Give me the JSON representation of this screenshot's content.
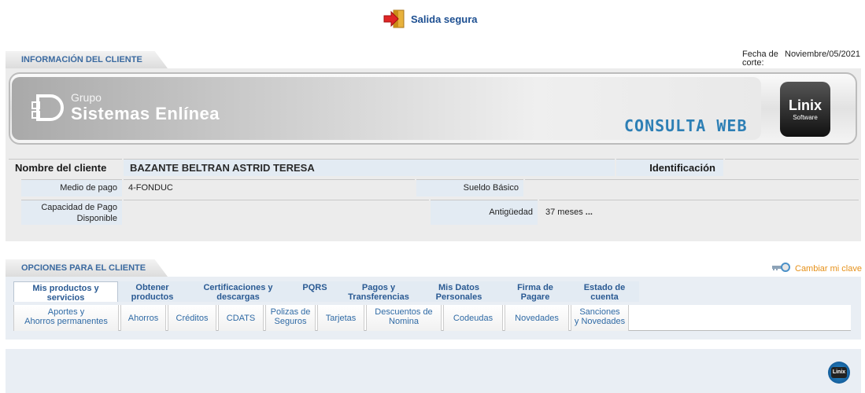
{
  "header": {
    "logout_label": "Salida segura"
  },
  "client_section": {
    "title": "INFORMACIÓN DEL CLIENTE",
    "fecha_label": "Fecha de corte:",
    "fecha_value": "Noviembre/05/2021",
    "banner": {
      "group_small": "Grupo",
      "group_name": "Sistemas Enlínea",
      "consulta": "CONSULTA WEB",
      "linix": "Linix",
      "software": "Software"
    },
    "fields": {
      "nombre_label": "Nombre del cliente",
      "nombre_value": "BAZANTE BELTRAN ASTRID TERESA",
      "identificacion_label": "Identificación",
      "medio_label": "Medio de pago",
      "medio_value": "4-FONDUC",
      "sueldo_label": "Sueldo Básico",
      "capacidad_label_1": "Capacidad de Pago",
      "capacidad_label_2": "Disponible",
      "antiguedad_label": "Antigüedad",
      "antiguedad_value": "37 meses",
      "antiguedad_more": "..."
    }
  },
  "options_section": {
    "title": "OPCIONES PARA EL CLIENTE",
    "cambiar_clave": "Cambiar mi clave",
    "main_tabs": [
      {
        "l1": "Mis productos y",
        "l2": "servicios"
      },
      {
        "l1": "Obtener",
        "l2": "productos"
      },
      {
        "l1": "Certificaciones y",
        "l2": "descargas"
      },
      {
        "l1": "PQRS",
        "l2": ""
      },
      {
        "l1": "Pagos y",
        "l2": "Transferencias"
      },
      {
        "l1": "Mis Datos",
        "l2": "Personales"
      },
      {
        "l1": "Firma de",
        "l2": "Pagare"
      },
      {
        "l1": "Estado de",
        "l2": "cuenta"
      }
    ],
    "sub_tabs": [
      {
        "l1": "Aportes y",
        "l2": "Ahorros permanentes"
      },
      {
        "l1": "Ahorros",
        "l2": ""
      },
      {
        "l1": "Créditos",
        "l2": ""
      },
      {
        "l1": "CDATS",
        "l2": ""
      },
      {
        "l1": "Polizas de",
        "l2": "Seguros"
      },
      {
        "l1": "Tarjetas",
        "l2": ""
      },
      {
        "l1": "Descuentos de",
        "l2": "Nomina"
      },
      {
        "l1": "Codeudas",
        "l2": ""
      },
      {
        "l1": "Novedades",
        "l2": ""
      },
      {
        "l1": "Sanciones",
        "l2": "y Novedades"
      }
    ]
  },
  "footer": {
    "logo_text": "Linix"
  }
}
